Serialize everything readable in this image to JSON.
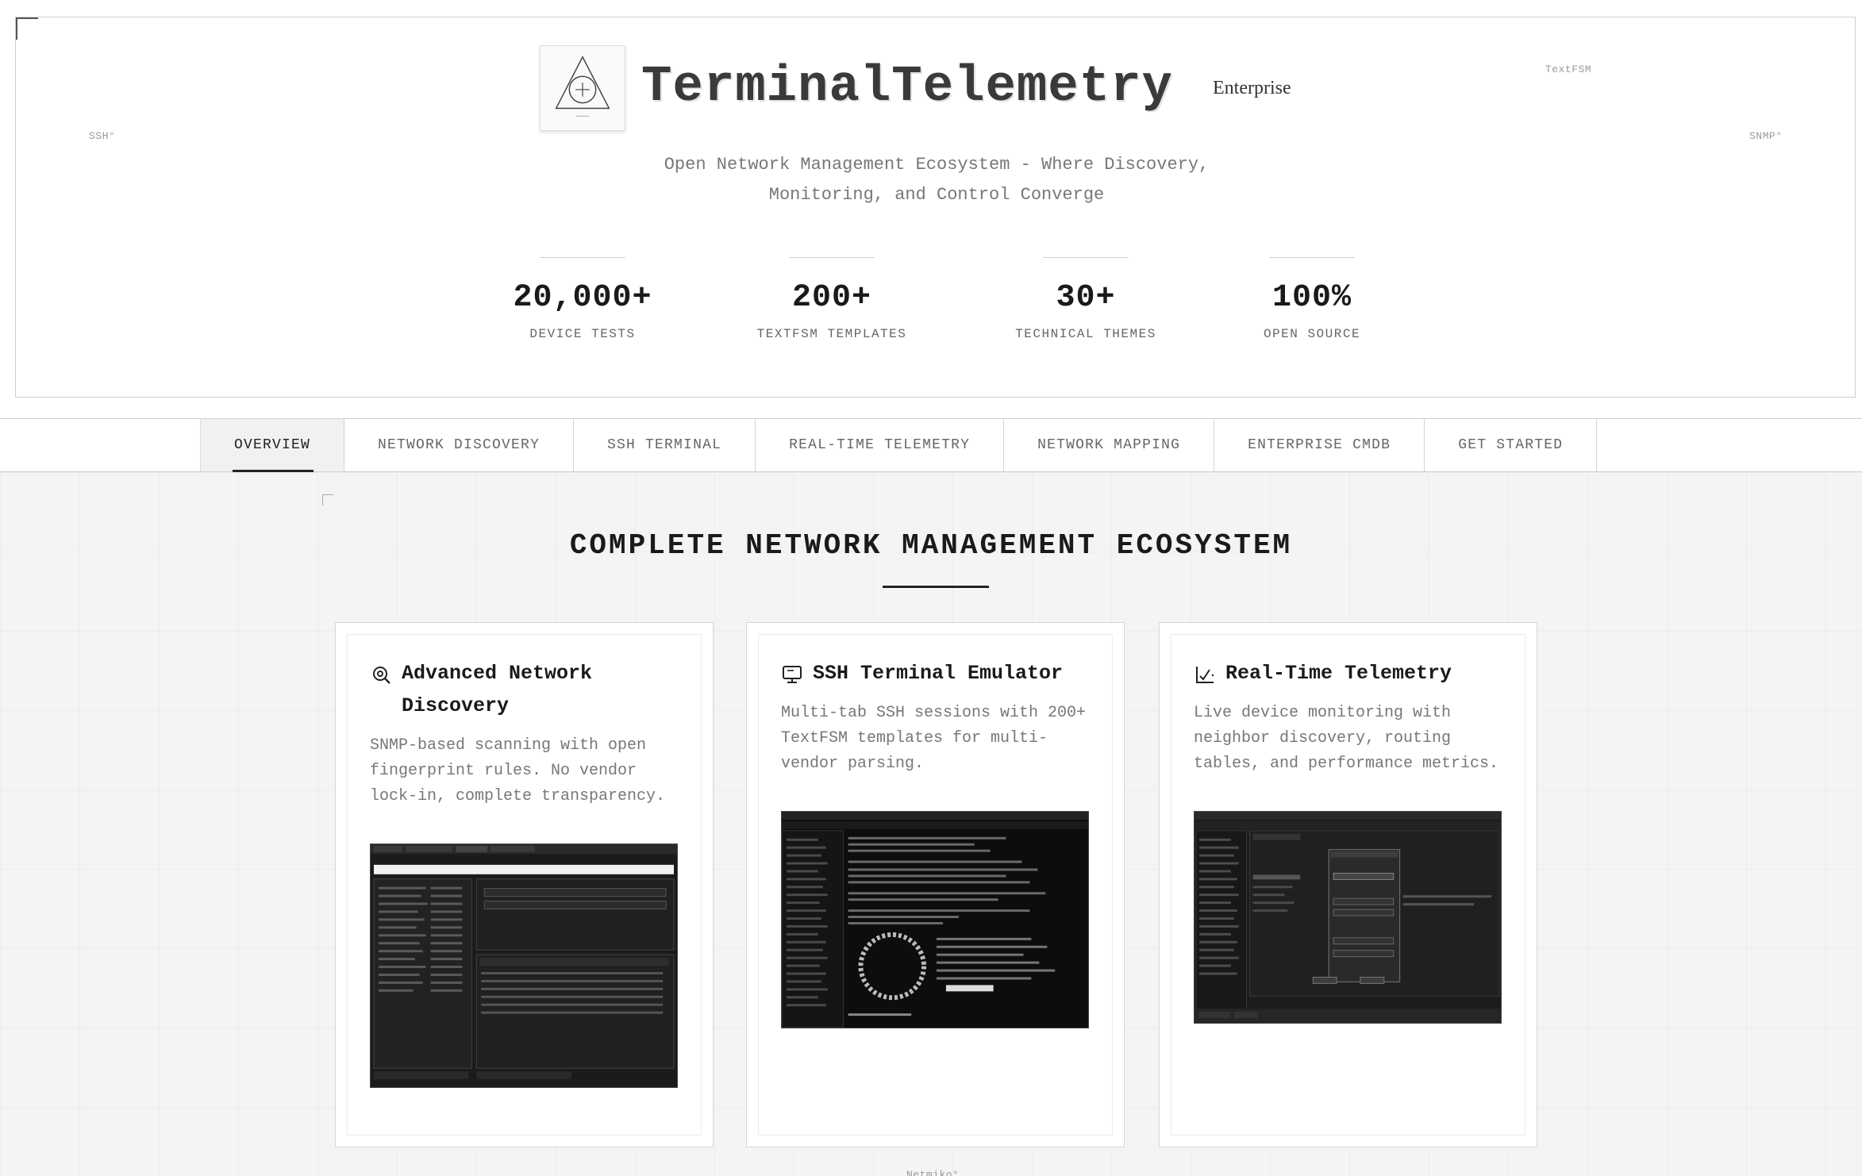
{
  "hero": {
    "title": "TerminalTelemetry",
    "badge": "Enterprise",
    "tagline": "Open Network Management Ecosystem - Where Discovery, Monitoring, and Control Converge",
    "floating_tags": [
      "SSH°",
      "TextFSM",
      "SNMP°"
    ],
    "stats": [
      {
        "value": "20,000+",
        "label": "DEVICE TESTS"
      },
      {
        "value": "200+",
        "label": "TEXTFSM TEMPLATES"
      },
      {
        "value": "30+",
        "label": "TECHNICAL THEMES"
      },
      {
        "value": "100%",
        "label": "OPEN SOURCE"
      }
    ]
  },
  "tabs": [
    {
      "label": "OVERVIEW",
      "active": true
    },
    {
      "label": "NETWORK DISCOVERY",
      "active": false
    },
    {
      "label": "SSH TERMINAL",
      "active": false
    },
    {
      "label": "REAL-TIME TELEMETRY",
      "active": false
    },
    {
      "label": "NETWORK MAPPING",
      "active": false
    },
    {
      "label": "ENTERPRISE CMDB",
      "active": false
    },
    {
      "label": "GET STARTED",
      "active": false
    }
  ],
  "section": {
    "title": "COMPLETE NETWORK MANAGEMENT ECOSYSTEM",
    "footer_tag": "Netmiko°"
  },
  "cards": [
    {
      "icon": "radar-search-icon",
      "title": "Advanced Network Discovery",
      "description": "SNMP-based scanning with open fingerprint rules. No vendor lock-in, complete transparency."
    },
    {
      "icon": "monitor-icon",
      "title": "SSH Terminal Emulator",
      "description": "Multi-tab SSH sessions with 200+ TextFSM templates for multi-vendor parsing."
    },
    {
      "icon": "chart-check-icon",
      "title": "Real-Time Telemetry",
      "description": "Live device monitoring with neighbor discovery, routing tables, and performance metrics."
    }
  ]
}
